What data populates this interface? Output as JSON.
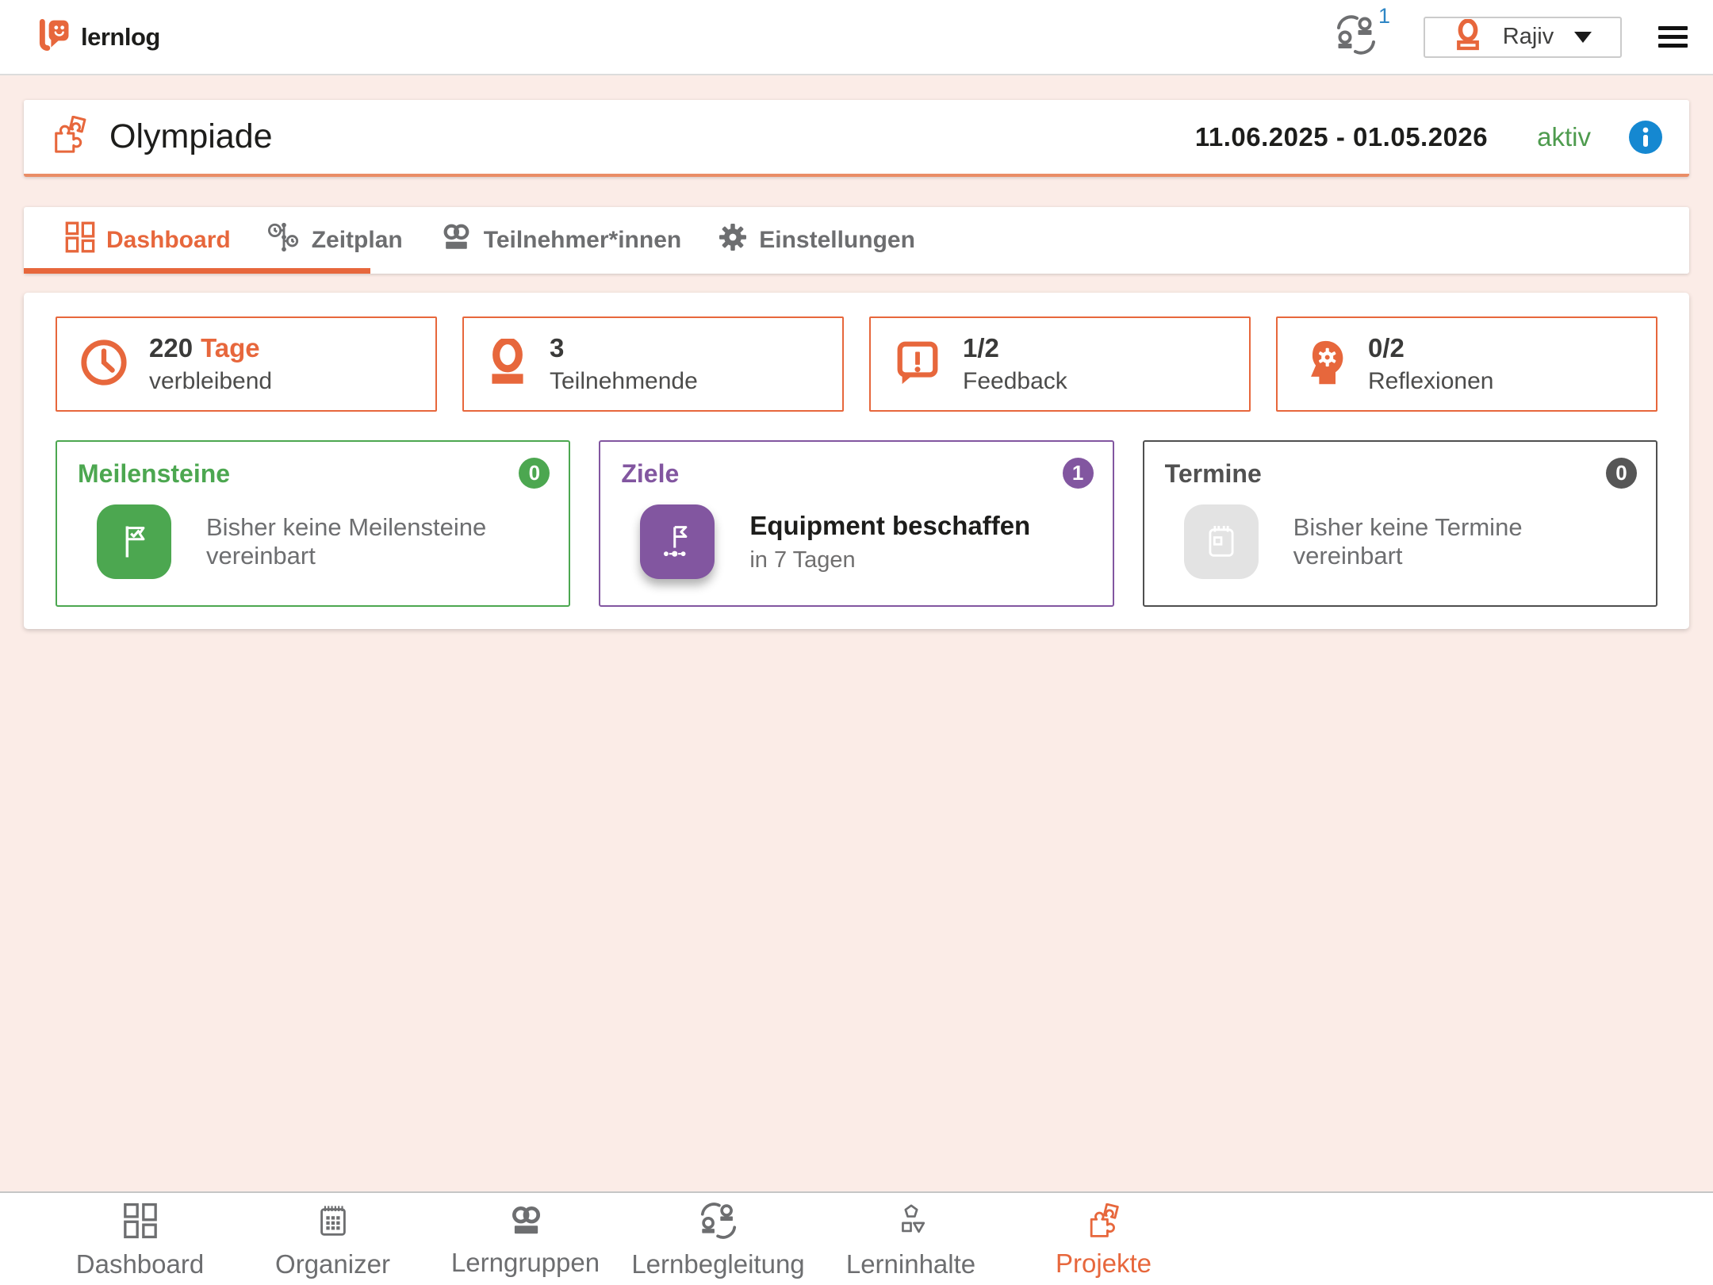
{
  "topbar": {
    "logo_text": "lernlog",
    "notification_badge": "1",
    "user_name": "Rajiv"
  },
  "project": {
    "title": "Olympiade",
    "date_range": "11.06.2025  -  01.05.2026",
    "status_label": "aktiv"
  },
  "tabs": [
    {
      "label": "Dashboard",
      "icon": "dashboard-grid-icon",
      "active": true
    },
    {
      "label": "Zeitplan",
      "icon": "timeline-clock-icon",
      "active": false
    },
    {
      "label": "Teilnehmer*innen",
      "icon": "people-icon",
      "active": false
    },
    {
      "label": "Einstellungen",
      "icon": "gear-icon",
      "active": false
    }
  ],
  "stats": [
    {
      "value": "220",
      "suffix": "Tage",
      "label": "verbleibend",
      "icon": "clock-icon"
    },
    {
      "value": "3",
      "label": "Teilnehmende",
      "icon": "person-icon"
    },
    {
      "value": "1/2",
      "label": "Feedback",
      "icon": "feedback-bubble-icon"
    },
    {
      "value": "0/2",
      "label": "Reflexionen",
      "icon": "reflection-head-icon"
    }
  ],
  "cards": {
    "milestones": {
      "title": "Meilensteine",
      "count": "0",
      "empty_text": "Bisher keine Meilensteine vereinbart",
      "color": "#4CA750"
    },
    "goals": {
      "title": "Ziele",
      "count": "1",
      "item_title": "Equipment beschaffen",
      "item_subtitle": "in 7 Tagen",
      "color": "#8256A0"
    },
    "appointments": {
      "title": "Termine",
      "count": "0",
      "empty_text": "Bisher keine Termine vereinbart",
      "color": "#565656"
    }
  },
  "bottom_nav": [
    {
      "label": "Dashboard",
      "icon": "dashboard-grid-icon",
      "active": false
    },
    {
      "label": "Organizer",
      "icon": "organizer-calendar-icon",
      "active": false
    },
    {
      "label": "Lerngruppen",
      "icon": "people-icon",
      "active": false
    },
    {
      "label": "Lernbegleitung",
      "icon": "mentoring-handover-icon",
      "active": false
    },
    {
      "label": "Lerninhalte",
      "icon": "shapes-icon",
      "active": false
    },
    {
      "label": "Projekte",
      "icon": "puzzle-icon",
      "active": true
    }
  ],
  "colors": {
    "accent_orange": "#E7673C",
    "green": "#4CA750",
    "purple": "#8256A0",
    "gray": "#6D6E70",
    "info_blue": "#1588D1",
    "badge_blue": "#2E86C5",
    "background_pink": "#FBECE7",
    "status_green": "#4E9B4E"
  }
}
